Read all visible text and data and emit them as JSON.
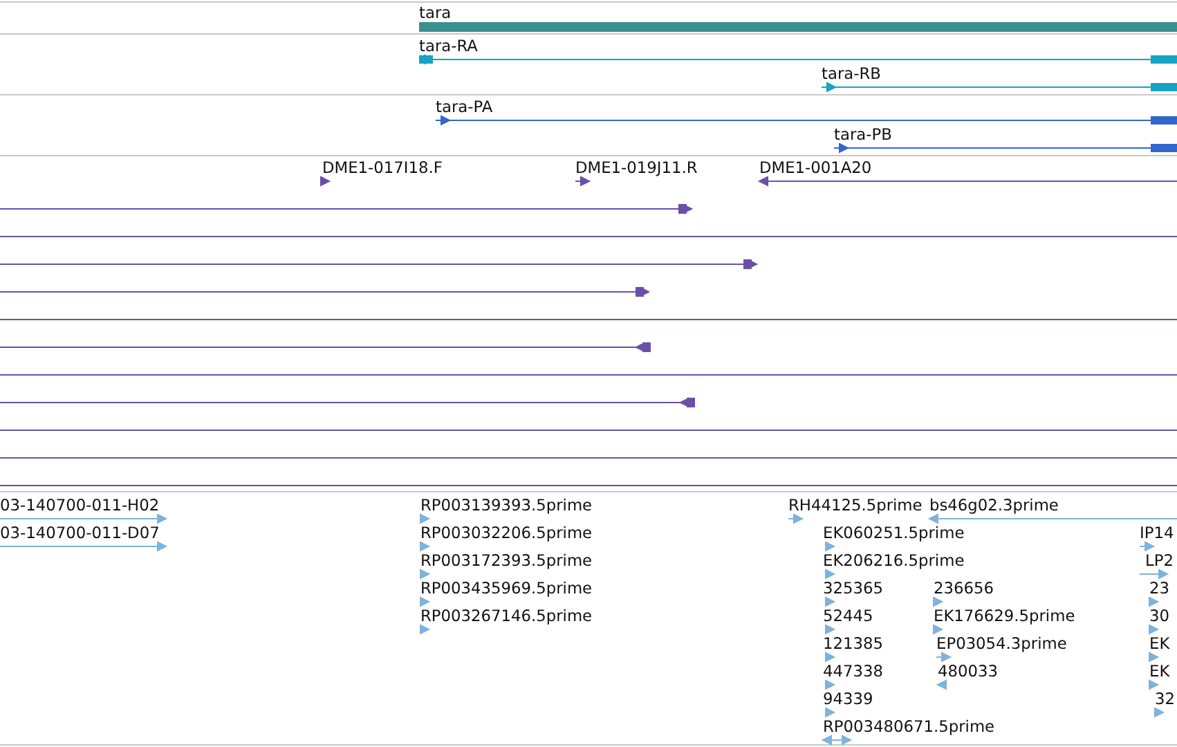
{
  "tracks": [
    {
      "kind": "gene",
      "features": [
        {
          "label": "tara",
          "kind": "forward"
        }
      ]
    },
    {
      "kind": "transcript",
      "features": [
        {
          "label": "tara-RA",
          "kind": "forward"
        },
        {
          "label": "tara-RB",
          "kind": "forward"
        }
      ]
    },
    {
      "kind": "protein",
      "features": [
        {
          "label": "tara-PA",
          "kind": "forward"
        },
        {
          "label": "tara-PB",
          "kind": "forward"
        }
      ]
    },
    {
      "kind": "clone",
      "features": [
        {
          "label": "DME1-017I18.F",
          "kind": "forward"
        },
        {
          "label": "DME1-019J11.R",
          "kind": "forward"
        },
        {
          "label": "DME1-001A20",
          "kind": "reverse"
        }
      ]
    },
    {
      "kind": "est",
      "features": [
        {
          "label": "03-140700-011-H02",
          "kind": "forward"
        },
        {
          "label": "RP003139393.5prime",
          "kind": "forward"
        },
        {
          "label": "RH44125.5prime",
          "kind": "forward"
        },
        {
          "label": "bs46g02.3prime",
          "kind": "reverse"
        },
        {
          "label": "03-140700-011-D07",
          "kind": "forward"
        },
        {
          "label": "RP003032206.5prime",
          "kind": "forward"
        },
        {
          "label": "EK060251.5prime",
          "kind": "forward"
        },
        {
          "label": "IP14",
          "kind": "forward"
        },
        {
          "label": "RP003172393.5prime",
          "kind": "forward"
        },
        {
          "label": "EK206216.5prime",
          "kind": "forward"
        },
        {
          "label": "LP2",
          "kind": "forward"
        },
        {
          "label": "RP003435969.5prime",
          "kind": "forward"
        },
        {
          "label": "325365",
          "kind": "forward"
        },
        {
          "label": "236656",
          "kind": "forward"
        },
        {
          "label": "23",
          "kind": "forward"
        },
        {
          "label": "RP003267146.5prime",
          "kind": "forward"
        },
        {
          "label": "52445",
          "kind": "forward"
        },
        {
          "label": "EK176629.5prime",
          "kind": "forward"
        },
        {
          "label": "30",
          "kind": "forward"
        },
        {
          "label": "121385",
          "kind": "forward"
        },
        {
          "label": "EP03054.3prime",
          "kind": "forward"
        },
        {
          "label": "EK",
          "kind": "forward"
        },
        {
          "label": "447338",
          "kind": "forward"
        },
        {
          "label": "480033",
          "kind": "reverse"
        },
        {
          "label": "EK",
          "kind": "forward"
        },
        {
          "label": "94339",
          "kind": "forward"
        },
        {
          "label": "32",
          "kind": "forward"
        },
        {
          "label": "RP003480671.5prime",
          "kind": "bidirectional"
        }
      ]
    }
  ]
}
